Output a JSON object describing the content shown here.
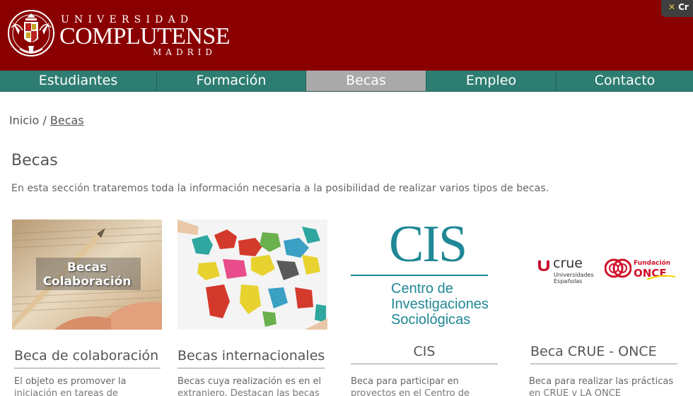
{
  "header": {
    "brand_top": "UNIVERSIDAD",
    "brand_main": "COMPLUTENSE",
    "brand_bottom": "MADRID",
    "corner_label": "Cr",
    "colors": {
      "header_bg": "#8a0000",
      "nav_bg": "#2e7d72",
      "nav_active": "#a9a9a9"
    }
  },
  "nav": {
    "items": [
      {
        "label": "Estudiantes"
      },
      {
        "label": "Formación"
      },
      {
        "label": "Becas"
      },
      {
        "label": "Empleo"
      },
      {
        "label": "Contacto"
      }
    ],
    "active_index": 2
  },
  "breadcrumb": {
    "home": "Inicio",
    "sep": "/",
    "current": "Becas"
  },
  "page": {
    "title": "Becas",
    "intro": "En esta sección trataremos toda la información necesaria a la posibilidad de realizar varios tipos de becas."
  },
  "cards": [
    {
      "image_text_1": "Becas",
      "image_text_2": "Colaboración",
      "title": "Beca de colaboración",
      "text_1": "El objeto es  promover la",
      "text_2": "iniciación en tareas de"
    },
    {
      "title": "Becas internacionales",
      "text_1": "Becas cuya realización es en el",
      "text_2": "extranjero. Destacan las becas"
    },
    {
      "logo_big": "CIS",
      "logo_line_1": "Centro de",
      "logo_line_2": "Investigaciones",
      "logo_line_3": "Sociológicas",
      "title": "CIS",
      "text_1": "Beca para participar en",
      "text_2": "proyectos en el Centro de"
    },
    {
      "crue_name": "crue",
      "crue_sub_1": "Universidades",
      "crue_sub_2": "Españolas",
      "once_label_1": "Fundación",
      "once_label_2": "ONCE",
      "title": "Beca CRUE - ONCE",
      "text_1": "Beca para realizar las prácticas",
      "text_2": "en CRUE y LA ONCE"
    }
  ]
}
